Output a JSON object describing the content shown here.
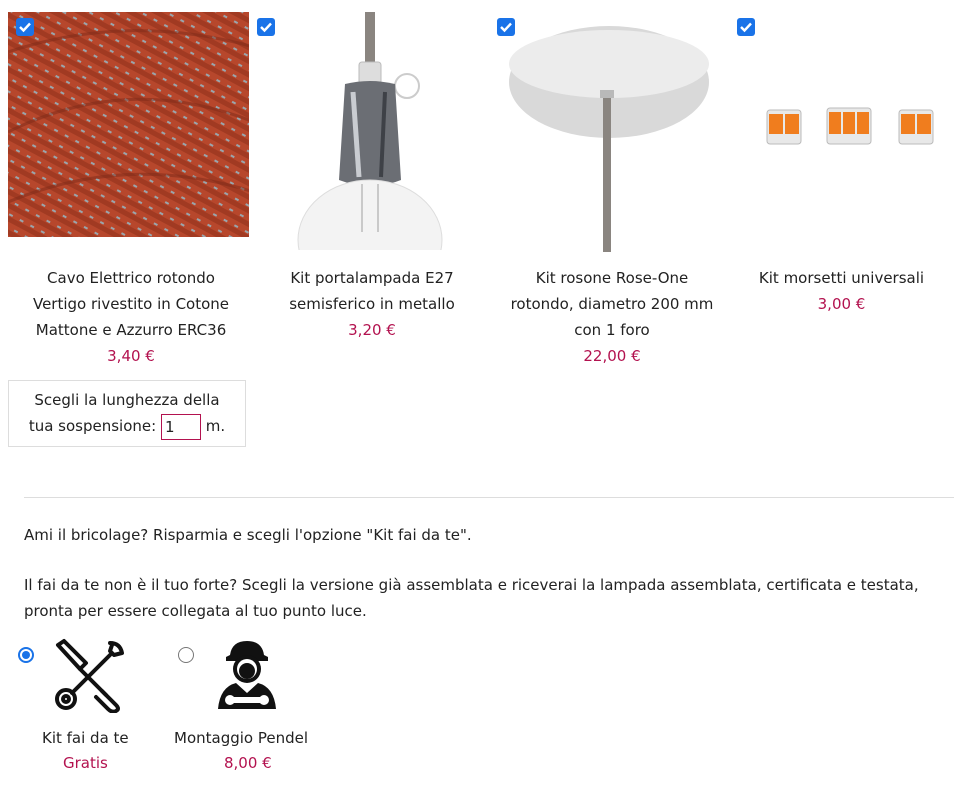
{
  "products": [
    {
      "title_lines": [
        "Cavo Elettrico rotondo",
        "Vertigo rivestito in Cotone",
        "Mattone e Azzurro ERC36"
      ],
      "price": "3,40 €",
      "checked": true
    },
    {
      "title_lines": [
        "Kit portalampada E27",
        "semisferico in metallo"
      ],
      "price": "3,20 €",
      "checked": true
    },
    {
      "title_lines": [
        "Kit rosone Rose-One",
        "rotondo, diametro 200 mm",
        "con 1 foro"
      ],
      "price": "22,00 €",
      "checked": true
    },
    {
      "title_lines": [
        "Kit morsetti universali"
      ],
      "price": "3,00 €",
      "checked": true
    }
  ],
  "length": {
    "line1": "Scegli la lunghezza della",
    "line2": "tua sospensione:",
    "value": "1",
    "unit": "m."
  },
  "info": {
    "para1": "Ami il bricolage? Risparmia e scegli l'opzione \"Kit fai da te\".",
    "para2": "Il fai da te non è il tuo forte? Scegli la versione già assemblata e riceverai la lampada assemblata, certificata e testata, pronta per essere collegata al tuo punto luce."
  },
  "options": [
    {
      "label": "Kit fai da te",
      "price": "Gratis",
      "selected": true,
      "icon": "tools-icon"
    },
    {
      "label": "Montaggio Pendel",
      "price": "8,00 €",
      "selected": false,
      "icon": "technician-icon"
    }
  ],
  "colors": {
    "accent": "#1a73e8",
    "price": "#b3124f"
  }
}
